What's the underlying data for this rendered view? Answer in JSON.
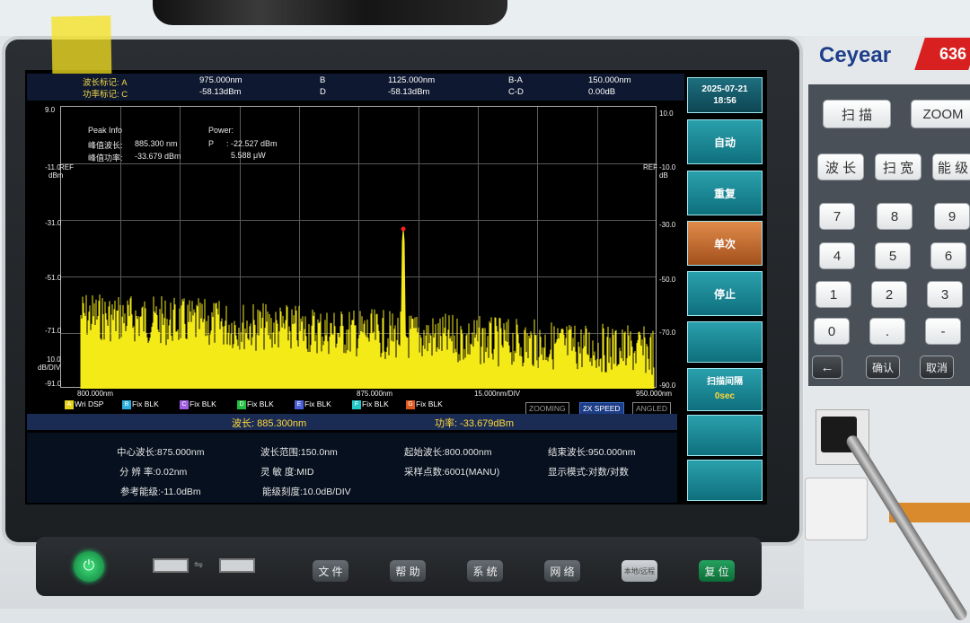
{
  "markers": {
    "row1": {
      "a_label": "波长标记: A",
      "a_value": "975.000nm",
      "b_label": "B",
      "b_value": "1125.000nm",
      "ba_label": "B-A",
      "ba_value": "150.000nm"
    },
    "row2": {
      "c_label": "功率标记: C",
      "c_value": "-58.13dBm",
      "d_label": "D",
      "d_value": "-58.13dBm",
      "cd_label": "C-D",
      "cd_value": "0.00dB"
    }
  },
  "chart": {
    "y_left": [
      "9.0",
      "-11.0",
      "-31.0",
      "-51.0",
      "-71.0",
      "-91.0"
    ],
    "y_right": [
      "10.0",
      "-10.0",
      "-30.0",
      "-50.0",
      "-70.0",
      "-90.0"
    ],
    "ref_left": "REF",
    "ref_right": "REF",
    "unit_left": "dBm",
    "unit_right": "dB",
    "scale_top": "10.0",
    "scale_bottom": "dB/DIV",
    "x_start": "800.000nm",
    "x_center": "875.000nm",
    "x_div": "15.000nm/DIV",
    "x_end": "950.000nm"
  },
  "peak_info": {
    "title": "Peak Info",
    "wl_label": "峰值波长:",
    "wl_value": "885.300 nm",
    "pw_label": "峰值功率:",
    "pw_value": "-33.679 dBm",
    "power_title": "Power:",
    "p_label": "P",
    "p_value": ": -22.527 dBm",
    "p_uw": "5.588 μW"
  },
  "traces": [
    {
      "letter": "A",
      "label": "Wri DSP",
      "color": "#e8d21a"
    },
    {
      "letter": "B",
      "label": "Fix BLK",
      "color": "#2bb0e0"
    },
    {
      "letter": "C",
      "label": "Fix BLK",
      "color": "#a060e0"
    },
    {
      "letter": "D",
      "label": "Fix BLK",
      "color": "#22c040"
    },
    {
      "letter": "E",
      "label": "Fix BLK",
      "color": "#4a60d8"
    },
    {
      "letter": "F",
      "label": "Fix BLK",
      "color": "#22c8c8"
    },
    {
      "letter": "G",
      "label": "Fix BLK",
      "color": "#e05a20"
    }
  ],
  "status": {
    "zooming": "ZOOMING",
    "speed": "2X SPEED",
    "angled": "ANGLED"
  },
  "readout": {
    "wl": "波长: 885.300nm",
    "pw": "功率: -33.679dBm"
  },
  "params": {
    "center": "中心波长:875.000nm",
    "span": "波长范围:150.0nm",
    "start": "起始波长:800.000nm",
    "stop": "结束波长:950.000nm",
    "res": "分 辨 率:0.02nm",
    "sens": "灵 敏 度:MID",
    "points": "采样点数:6001(MANU)",
    "display": "显示模式:对数/对数",
    "ref": "参考能级:-11.0dBm",
    "scale": "能级刻度:10.0dB/DIV"
  },
  "softkeys": {
    "date": "2025-07-21",
    "time": "18:56",
    "auto": "自动",
    "repeat": "重复",
    "single": "单次",
    "stop": "停止",
    "interval": "扫描间隔",
    "interval_val": "0sec"
  },
  "brand": {
    "logo": "Ceyear",
    "model": "636"
  },
  "panel_keys": {
    "scan": "扫 描",
    "zoom": "ZOOM",
    "wl": "波 长",
    "span": "扫 宽",
    "level": "能 级",
    "k7": "7",
    "k8": "8",
    "k9": "9",
    "k4": "4",
    "k5": "5",
    "k6": "6",
    "k1": "1",
    "k2": "2",
    "k3": "3",
    "k0": "0",
    "dot": ".",
    "minus": "-",
    "back": "←",
    "ok": "确认",
    "cancel": "取消"
  },
  "bottom_buttons": {
    "file": "文 件",
    "help": "帮 助",
    "system": "系 统",
    "network": "网 络",
    "local": "本地/远程",
    "reset": "复 位"
  },
  "colors": {
    "trace": "#f4ea17",
    "accent": "#ffd83a",
    "softkey": "#1a8e9b",
    "softkey_active": "#c4692c",
    "grid": "#5a5a5a"
  }
}
